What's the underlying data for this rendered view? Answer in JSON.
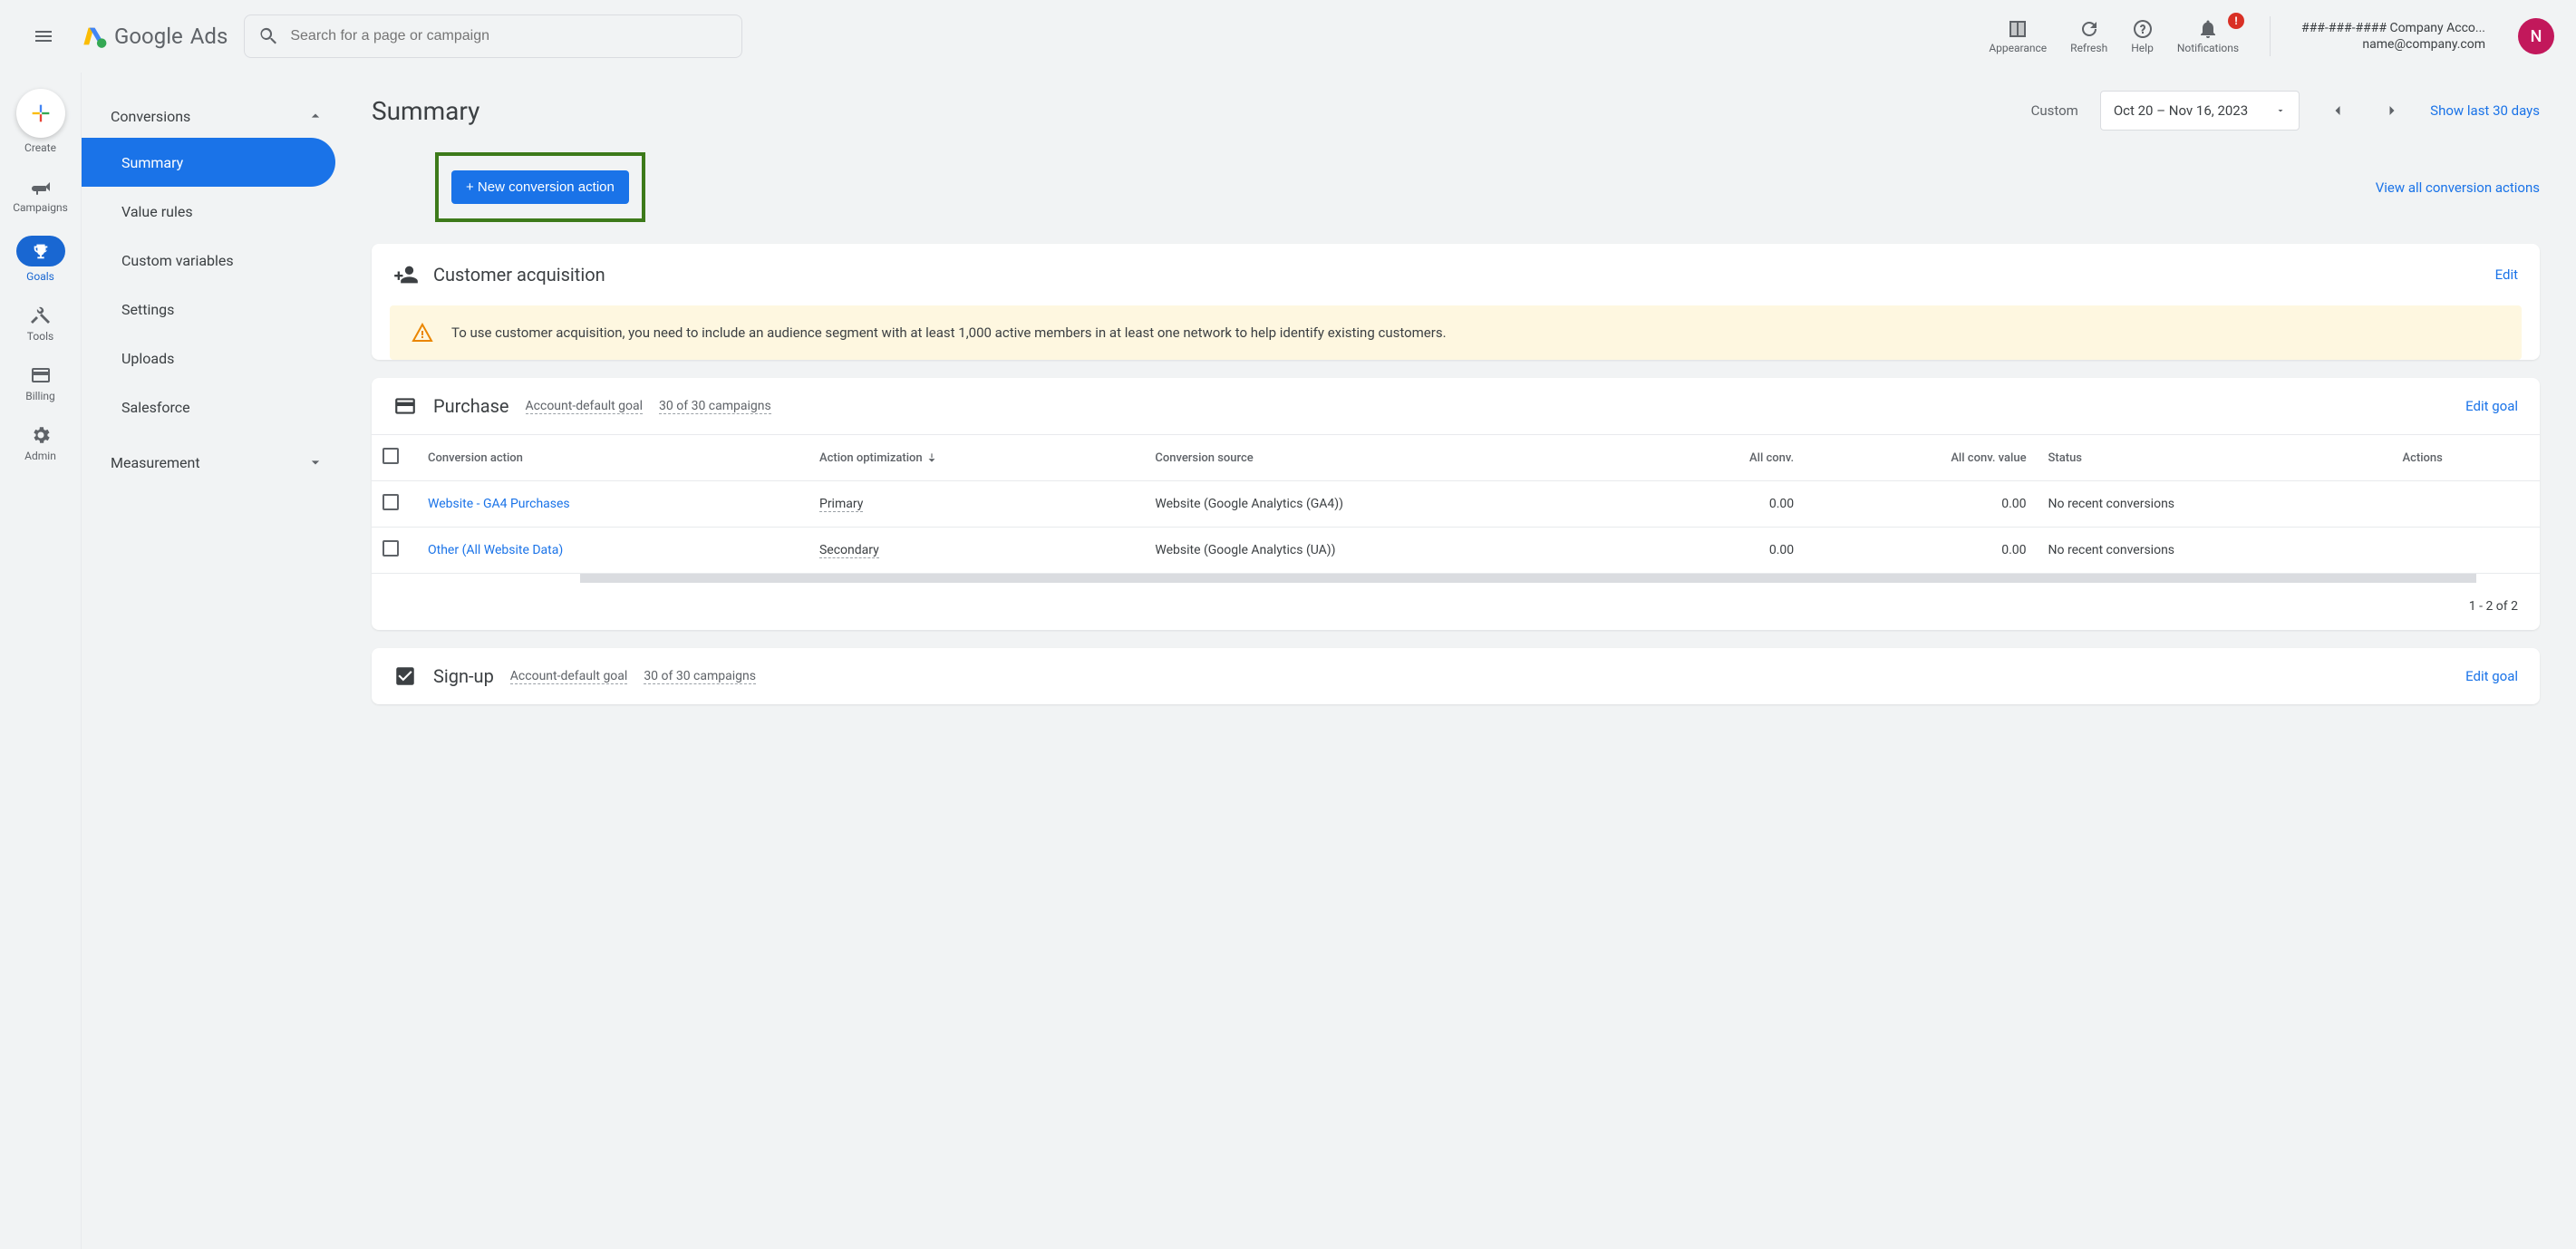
{
  "top": {
    "brand_google": "Google",
    "brand_ads": "Ads",
    "search_placeholder": "Search for a page or campaign",
    "appearance": "Appearance",
    "refresh": "Refresh",
    "help": "Help",
    "notifications": "Notifications",
    "notif_badge": "!",
    "account_line1": "###-###-#### Company Acco...",
    "account_line2": "name@company.com",
    "avatar_letter": "N"
  },
  "rail": {
    "create": "Create",
    "campaigns": "Campaigns",
    "goals": "Goals",
    "tools": "Tools",
    "billing": "Billing",
    "admin": "Admin"
  },
  "sidebar": {
    "section_conversions": "Conversions",
    "items": [
      {
        "label": "Summary"
      },
      {
        "label": "Value rules"
      },
      {
        "label": "Custom variables"
      },
      {
        "label": "Settings"
      },
      {
        "label": "Uploads"
      },
      {
        "label": "Salesforce"
      }
    ],
    "section_measurement": "Measurement"
  },
  "header": {
    "title": "Summary",
    "date_label": "Custom",
    "date_range": "Oct 20 – Nov 16, 2023",
    "show_last": "Show last 30 days"
  },
  "actions": {
    "new_conversion": "+ New conversion action",
    "view_all": "View all conversion actions"
  },
  "acquisition": {
    "title": "Customer acquisition",
    "edit": "Edit",
    "warning": "To use customer acquisition, you need to include an audience segment with at least 1,000 active members in at least one network to help identify existing customers."
  },
  "purchase": {
    "title": "Purchase",
    "default_goal": "Account-default goal",
    "campaigns": "30 of 30 campaigns",
    "edit": "Edit goal",
    "cols": {
      "action": "Conversion action",
      "optimization": "Action optimization",
      "source": "Conversion source",
      "all_conv": "All conv.",
      "value": "All conv. value",
      "status": "Status",
      "actions": "Actions"
    },
    "rows": [
      {
        "name": "Website - GA4 Purchases",
        "opt": "Primary",
        "src": "Website (Google Analytics (GA4))",
        "conv": "0.00",
        "val": "0.00",
        "status": "No recent conversions"
      },
      {
        "name": "Other (All Website Data)",
        "opt": "Secondary",
        "src": "Website (Google Analytics (UA))",
        "conv": "0.00",
        "val": "0.00",
        "status": "No recent conversions"
      }
    ],
    "pagination": "1 - 2 of 2"
  },
  "signup": {
    "title": "Sign-up",
    "default_goal": "Account-default goal",
    "campaigns": "30 of 30 campaigns",
    "edit": "Edit goal"
  }
}
